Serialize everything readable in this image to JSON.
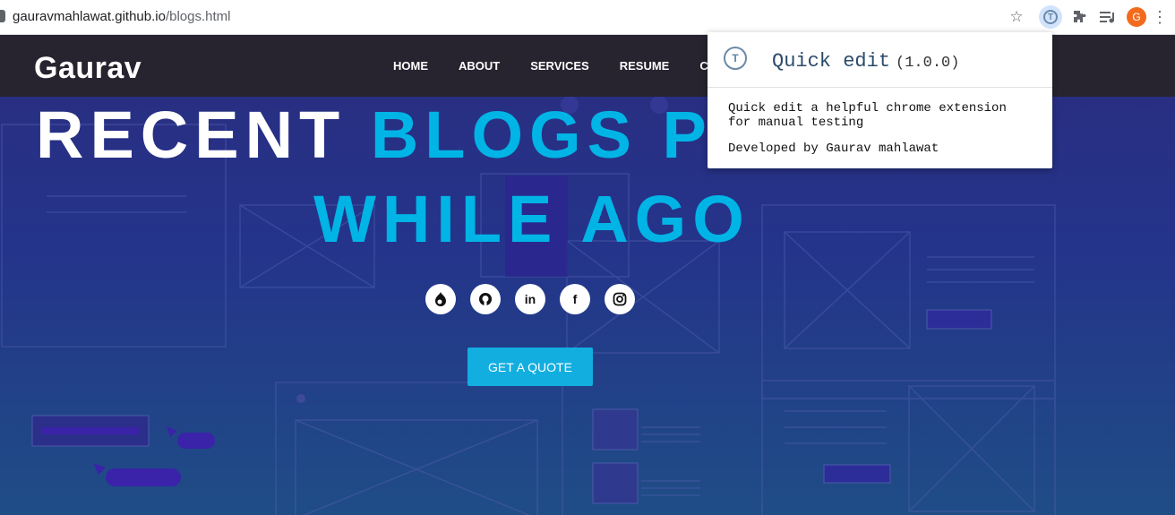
{
  "browser": {
    "url_domain": "gauravmahlawat.github.io",
    "url_path": "/blogs.html",
    "avatar_initial": "G"
  },
  "site": {
    "brand": "Gaurav",
    "nav": [
      "HOME",
      "ABOUT",
      "SERVICES",
      "RESUME",
      "CON"
    ]
  },
  "hero": {
    "title_white": "RECENT",
    "title_blue_1": "BLOGS PO",
    "title_blue_2": "WHILE AGO",
    "cta": "GET A QUOTE",
    "socials": [
      "drupal-icon",
      "github-icon",
      "linkedin-icon",
      "facebook-icon",
      "instagram-icon"
    ]
  },
  "popup": {
    "title": "Quick edit",
    "version": "(1.0.0)",
    "description": "Quick edit a helpful chrome extension for manual testing",
    "developer": "Developed by Gaurav mahlawat"
  },
  "colors": {
    "accent": "#00b4e6",
    "navbar": "#27232f",
    "button": "#12aee0"
  }
}
